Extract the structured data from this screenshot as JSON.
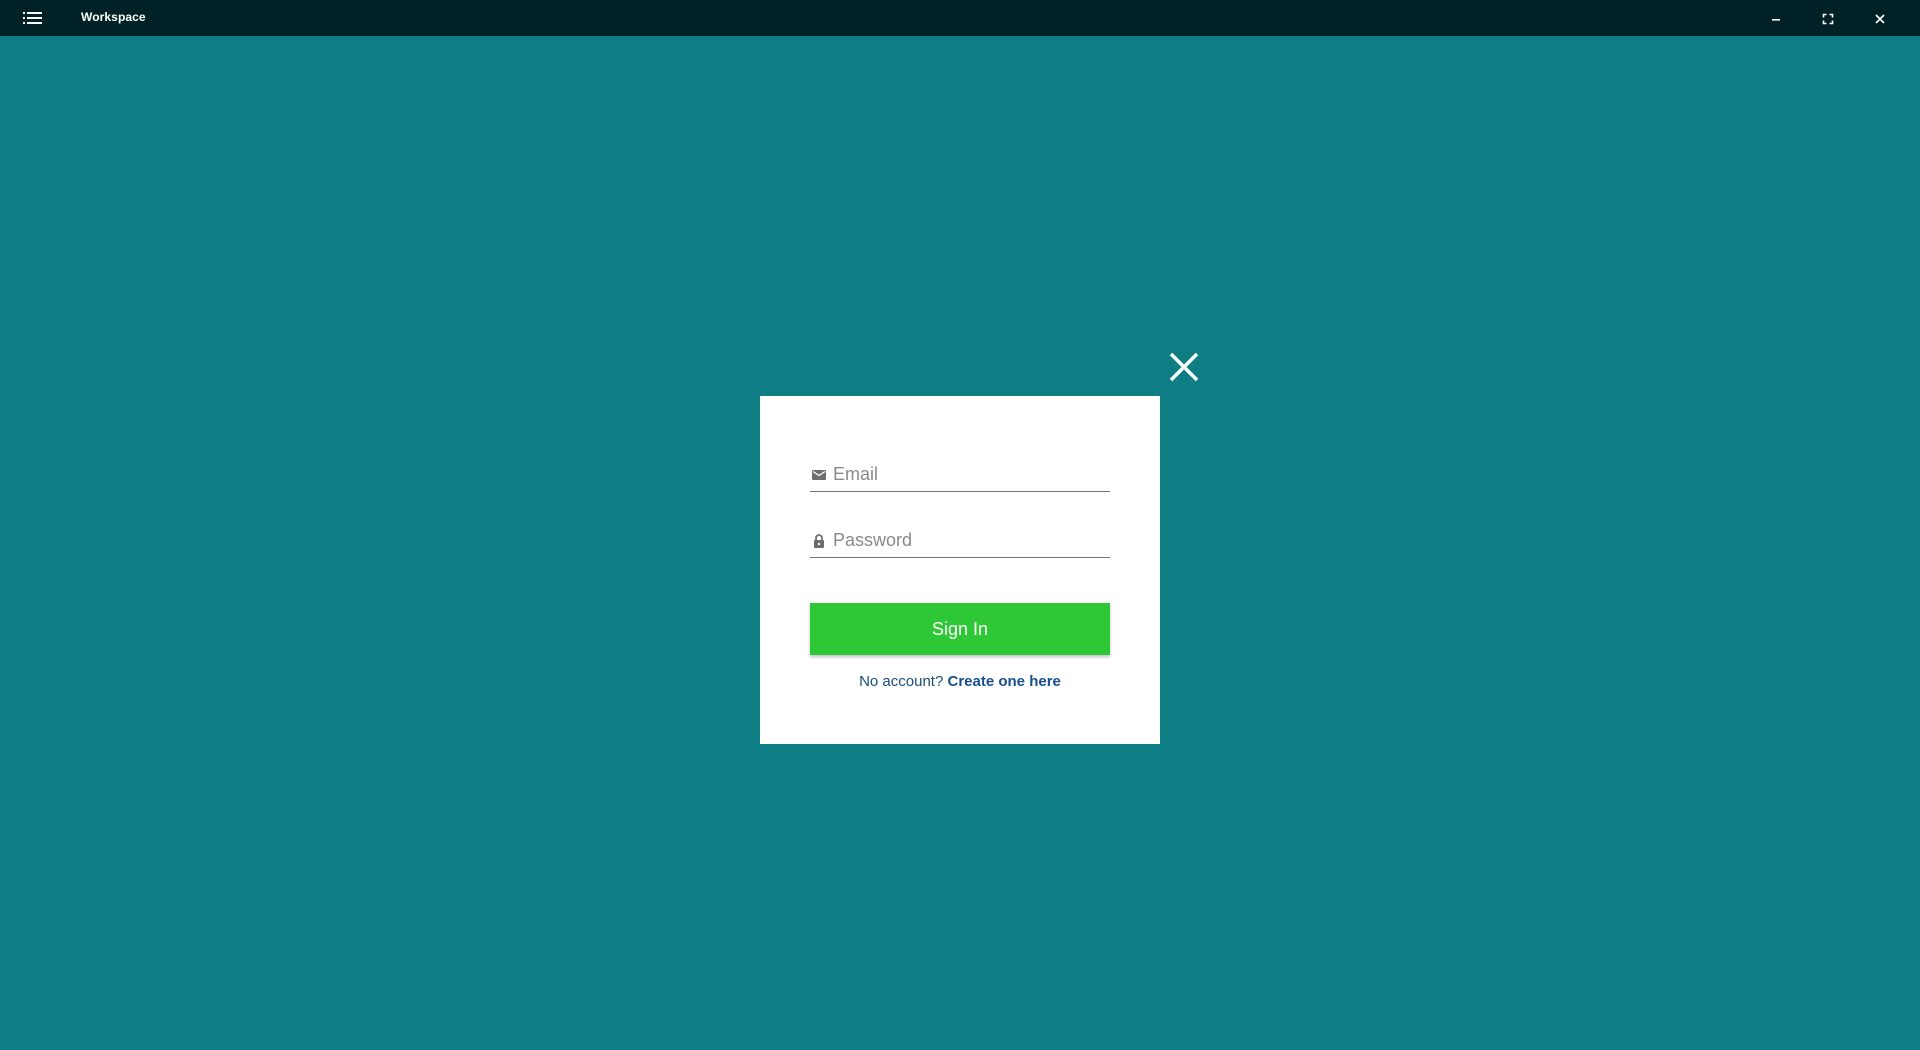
{
  "window": {
    "title": "Workspace",
    "menu_icon": "hamburger-list-icon",
    "minimize_icon": "minimize-icon",
    "maximize_icon": "maximize-icon",
    "close_icon": "close-icon"
  },
  "modal": {
    "close_icon": "close-icon",
    "email": {
      "placeholder": "Email",
      "value": "",
      "icon": "mail-icon"
    },
    "password": {
      "placeholder": "Password",
      "value": "",
      "icon": "lock-icon"
    },
    "sign_in_label": "Sign In",
    "signup_prompt": "No account?",
    "signup_link": "Create one here"
  },
  "colors": {
    "background": "#0e7e84",
    "titlebar": "#002226",
    "button": "#2ec836",
    "link": "#17508d"
  }
}
